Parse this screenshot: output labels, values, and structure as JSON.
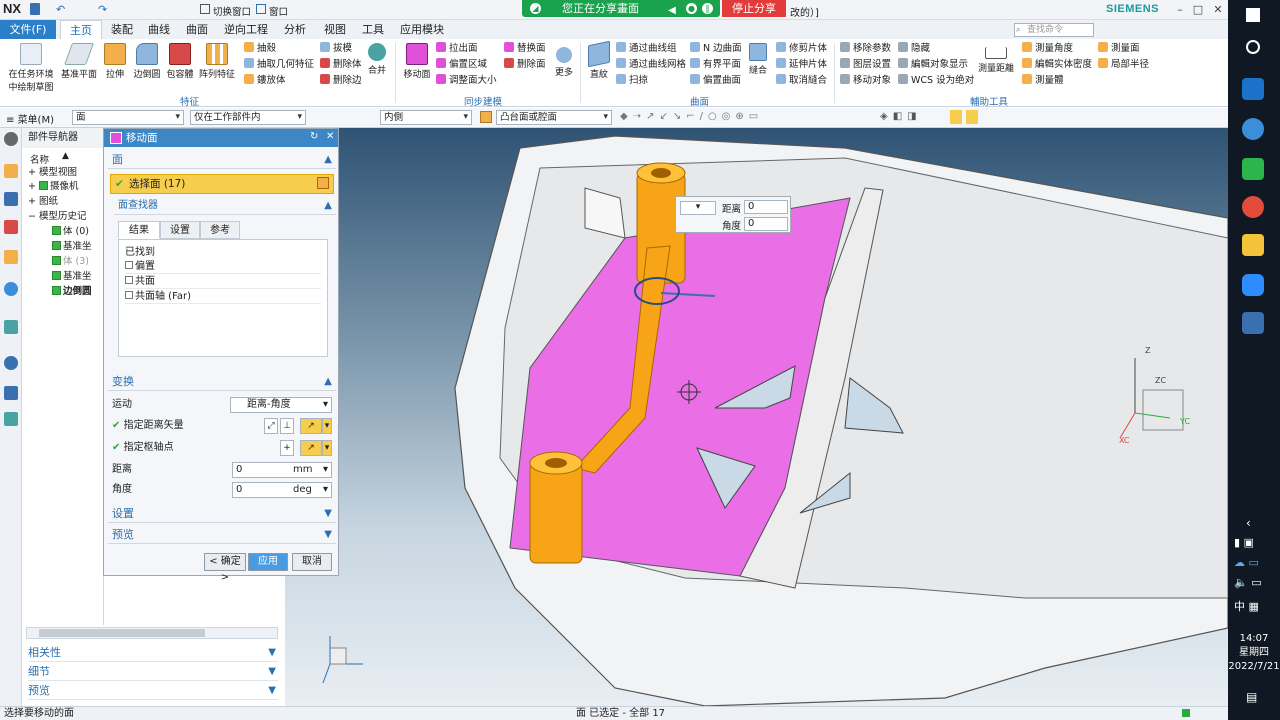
{
  "title_bar": {
    "app": "NX",
    "switch_window": "切换窗口",
    "window_menu": "窗口",
    "title_fragment": "改的）]",
    "brand": "SIEMENS"
  },
  "share": {
    "sharing_text": "您正在分享畫面",
    "stop_label": "停止分享"
  },
  "ribbon_tabs": [
    "文件(F)",
    "主页",
    "装配",
    "曲线",
    "曲面",
    "逆向工程",
    "分析",
    "视图",
    "工具",
    "应用模块"
  ],
  "search_placeholder": "查找命令",
  "ribbon": {
    "big_buttons": [
      {
        "label1": "在任务环境",
        "label2": "中绘制草图"
      },
      {
        "label1": "基准平面"
      },
      {
        "label1": "拉伸"
      },
      {
        "label1": "边倒圆"
      },
      {
        "label1": "包容體"
      },
      {
        "label1": "阵列特征"
      }
    ],
    "feature_items": [
      "抽殼",
      "抽取几何特征",
      "鏤放体"
    ],
    "feature_items2": [
      "拔模",
      "删除体",
      "删除边"
    ],
    "merge": "合并",
    "feature_group": "特征",
    "sync_big": "移动面",
    "sync_items": [
      "拉出面",
      "偏置区域",
      "调整面大小"
    ],
    "sync_items2": [
      "替换面",
      "删除面"
    ],
    "more": "更多",
    "sync_group": "同步建模",
    "surface_big": "直紋",
    "surface_items": [
      "通过曲线组",
      "通过曲线网格",
      "扫掠"
    ],
    "surface_items2": [
      "N 边曲面",
      "有界平面",
      "偏置曲面"
    ],
    "sew": "縫合",
    "surface_items3": [
      "修剪片体",
      "延伸片体",
      "取消縫合"
    ],
    "surface_group": "曲面",
    "aux_items": [
      "移除参数",
      "图层设置",
      "移动对象"
    ],
    "aux_items2": [
      "隐藏",
      "編輯对象显示",
      "WCS 设为绝对"
    ],
    "measure_distance": "測量距離",
    "aux_items3": [
      "測量角度",
      "編輯实体密度",
      "測量體"
    ],
    "aux_items4": [
      "測量面",
      "局部半径"
    ],
    "aux_group": "輔助工具"
  },
  "toolbar2": {
    "menu": "菜单(M)",
    "filter": "面",
    "scope": "仅在工作部件内",
    "face_rule": "内側",
    "region": "凸台面或腔面"
  },
  "navigator": {
    "title": "部件导航器",
    "col_name": "名称",
    "items": [
      "模型视图",
      "摄像机",
      "图纸",
      "模型历史记",
      "体 (0)",
      "基准坐",
      "体 (3)",
      "基准坐",
      "边倒圆"
    ]
  },
  "nav_accordions": [
    "相关性",
    "细节",
    "预览"
  ],
  "dialog": {
    "title": "移动面",
    "face_section": "面",
    "select_face": "选择面 (17)",
    "face_finder": "面查找器",
    "tabs": [
      "结果",
      "设置",
      "参考"
    ],
    "found_label": "已找到",
    "found_items": [
      "偏置",
      "共面",
      "共面轴 (Far)"
    ],
    "transform_section": "变换",
    "motion_label": "运动",
    "motion_value": "距离-角度",
    "vector_label": "指定距离矢量",
    "pivot_label": "指定枢轴点",
    "distance_label": "距离",
    "distance_value": "0",
    "distance_unit": "mm",
    "angle_label": "角度",
    "angle_value": "0",
    "angle_unit": "deg",
    "settings_section": "设置",
    "preview_section": "预览",
    "ok": "< 确定 >",
    "apply": "应用",
    "cancel": "取消"
  },
  "mini_dialog": {
    "distance_label": "距离",
    "distance_value": "0",
    "angle_label": "角度",
    "angle_value": "0"
  },
  "triad_labels": [
    "ZC",
    "YC",
    "XC",
    "Z"
  ],
  "status": {
    "left": "选择要移动的面",
    "center": "面 已选定 - 全部 17"
  },
  "clock": {
    "time": "14:07",
    "day": "星期四",
    "date": "2022/7/21"
  },
  "ime": "中"
}
